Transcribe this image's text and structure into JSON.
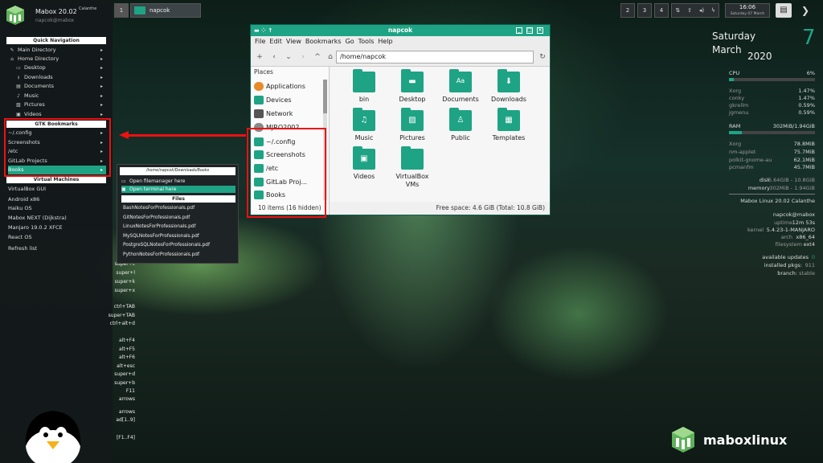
{
  "sidebar": {
    "app_title": "Mabox 20.02",
    "codename": "Calanthe",
    "user": "napcok@mabox",
    "sections": {
      "quick_nav": "Quick Navigation",
      "gtk_bookmarks": "GTK Bookmarks",
      "virtual_machines": "Virtual Machines"
    },
    "quick_nav": [
      {
        "label": "Main Directory",
        "icon": "pencil-icon"
      },
      {
        "label": "Home Directory",
        "icon": "home-icon"
      },
      {
        "label": "Desktop",
        "icon": "monitor-icon"
      },
      {
        "label": "Downloads",
        "icon": "download-icon"
      },
      {
        "label": "Documents",
        "icon": "document-icon"
      },
      {
        "label": "Music",
        "icon": "music-icon"
      },
      {
        "label": "Pictures",
        "icon": "picture-icon"
      },
      {
        "label": "Videos",
        "icon": "video-icon"
      }
    ],
    "bookmarks": [
      "~/.config",
      "Screenshots",
      "/etc",
      "GitLab Projects",
      "Books"
    ],
    "vms": [
      "VirtualBox GUI",
      "Android x86",
      "Haiku OS",
      "Mabox NEXT (Dijkstra)",
      "Manjaro 19.0.2 XFCE",
      "React OS"
    ],
    "refresh": "Refresh list",
    "keys": [
      "super+c",
      "super+l",
      "super+k",
      "super+x",
      "ctrl+TAB",
      "super+TAB",
      "ctrl+alt+d",
      "alt+F4",
      "alt+F5",
      "alt+F6",
      "alt+esc",
      "super+d",
      "super+b",
      "F11",
      "arrows",
      "arrows",
      "ad[1..9]",
      "[F1..F4]"
    ]
  },
  "topbar": {
    "workspace_active": "1",
    "task_label": "napcok",
    "workspaces": [
      "2",
      "3",
      "4"
    ],
    "clock_time": "16:06",
    "clock_date": "Saturday 07 March"
  },
  "filemanager": {
    "title": "napcok",
    "menu": [
      "File",
      "Edit",
      "View",
      "Bookmarks",
      "Go",
      "Tools",
      "Help"
    ],
    "path": "/home/napcok",
    "places_header": "Places",
    "places": [
      {
        "label": "Applications",
        "color": "#e88a2a"
      },
      {
        "label": "Devices",
        "color": "#1fa385"
      },
      {
        "label": "Network",
        "color": "#555555"
      },
      {
        "label": "MJRO2002",
        "color": "#888888"
      },
      {
        "label": "~/.config",
        "color": "#1fa385"
      },
      {
        "label": "Screenshots",
        "color": "#1fa385"
      },
      {
        "label": "/etc",
        "color": "#1fa385"
      },
      {
        "label": "GitLab Proj...",
        "color": "#1fa385"
      },
      {
        "label": "Books",
        "color": "#1fa385"
      }
    ],
    "files": [
      {
        "label": "bin",
        "glyph": ""
      },
      {
        "label": "Desktop",
        "glyph": "▬"
      },
      {
        "label": "Documents",
        "glyph": "Aa"
      },
      {
        "label": "Downloads",
        "glyph": "⬇"
      },
      {
        "label": "Music",
        "glyph": "♫"
      },
      {
        "label": "Pictures",
        "glyph": "▨"
      },
      {
        "label": "Public",
        "glyph": "♙"
      },
      {
        "label": "Templates",
        "glyph": "▦"
      },
      {
        "label": "Videos",
        "glyph": "▣"
      },
      {
        "label": "VirtualBox VMs",
        "glyph": ""
      }
    ],
    "status_left": "10 items (16 hidden)",
    "status_right": "Free space: 4.6 GiB (Total: 10.8 GiB)"
  },
  "popup": {
    "path": "/home/napcok/Downloads/Books",
    "open_fm": "Open filemanager here",
    "open_term": "Open terminal here",
    "files_header": "Files",
    "files": [
      "BashNotesForProfessionals.pdf",
      "GitNotesForProfessionals.pdf",
      "LinuxNotesForProfessionals.pdf",
      "MySQLNotesForProfessionals.pdf",
      "PostgreSQLNotesForProfessionals.pdf",
      "PythonNotesForProfessionals.pdf"
    ]
  },
  "conky": {
    "day": "Saturday",
    "month": "March",
    "year": "2020",
    "daynum": "7",
    "cpu_label": "CPU",
    "cpu_value": "6%",
    "cpu_fraction": 0.06,
    "cpu_procs": [
      [
        "Xorg",
        "1.47%"
      ],
      [
        "conky",
        "1.47%"
      ],
      [
        "gkrellm",
        "0.59%"
      ],
      [
        "jgmenu",
        "0.59%"
      ]
    ],
    "ram_label": "RAM",
    "ram_value": "302MiB/1.94GiB",
    "ram_fraction": 0.15,
    "ram_procs": [
      [
        "Xorg",
        "78.8MiB"
      ],
      [
        "nm-applet",
        "75.7MiB"
      ],
      [
        "polkit-gnome-au",
        "62.1MiB"
      ],
      [
        "pcmanfm",
        "45.7MiB"
      ]
    ],
    "disk_label": "disk",
    "disk_value": "5.64GiB - 10.8GiB",
    "memory_label": "memory",
    "memory_value": "302MiB - 1.94GiB",
    "distro": "Mabox Linux 20.02 Calanthe",
    "userhost": "napcok@mabox",
    "uptime_label": "uptime",
    "uptime_value": "12m 53s",
    "kernel_label": "kernel",
    "kernel_value": "5.4.23-1-MANJARO",
    "arch_label": "arch",
    "arch_value": "x86_64",
    "fs_label": "filesystem",
    "fs_value": "ext4",
    "updates_label": "available updates",
    "updates_value": "0",
    "installed_label": "installed pkgs:",
    "installed_value": "911",
    "branch_label": "branch:",
    "branch_value": "stable"
  },
  "brand": "maboxlinux",
  "colors": {
    "accent": "#1fa385",
    "highlight_red": "#e11111"
  }
}
